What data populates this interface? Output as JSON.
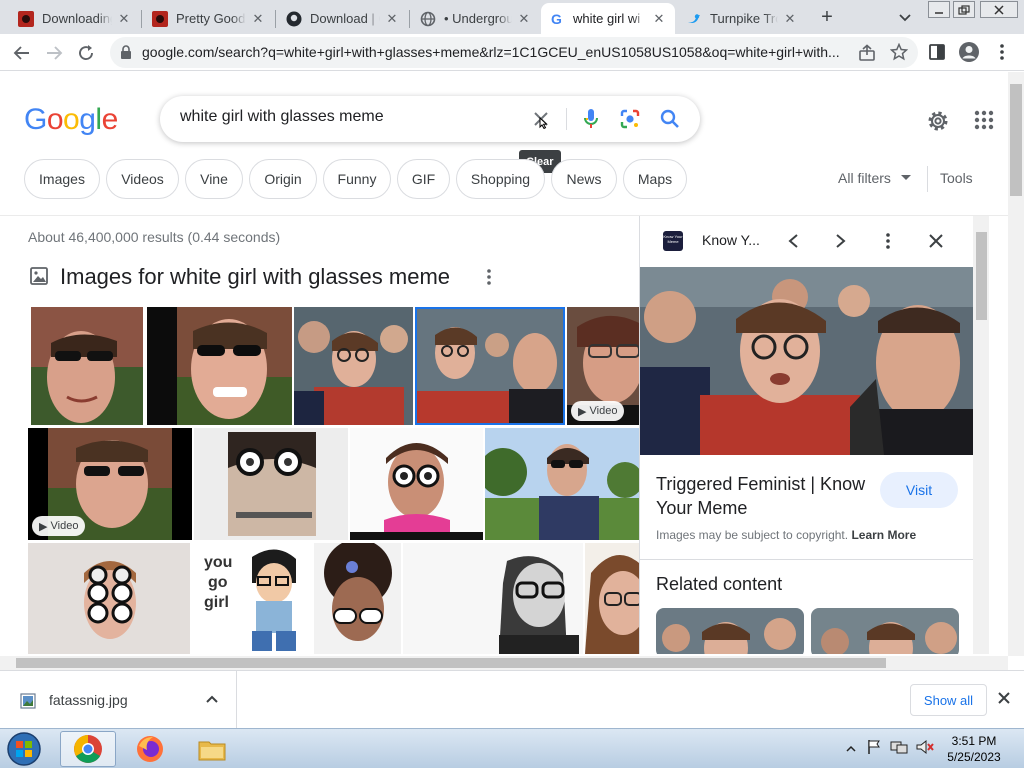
{
  "browser": {
    "tabs": [
      {
        "title": "Downloading",
        "icon": "red-favicon-icon"
      },
      {
        "title": "Pretty Good",
        "icon": "red-favicon-icon"
      },
      {
        "title": "Download | C",
        "icon": "github-icon"
      },
      {
        "title": "• Undergrou",
        "icon": "globe-icon"
      },
      {
        "title": "white girl wi",
        "icon": "google-icon",
        "active": true
      },
      {
        "title": "Turnpike Tro",
        "icon": "twitter-icon"
      }
    ],
    "url": "google.com/search?q=white+girl+with+glasses+meme&rlz=1C1GCEU_enUS1058US1058&oq=white+girl+with..."
  },
  "google": {
    "logo": [
      "G",
      "o",
      "o",
      "g",
      "l",
      "e"
    ],
    "logo_colors": [
      "#4285F4",
      "#EA4335",
      "#FBBC05",
      "#4285F4",
      "#34A853",
      "#EA4335"
    ],
    "query": "white girl with glasses meme",
    "clear_tooltip": "Clear",
    "chips": [
      "Images",
      "Videos",
      "Vine",
      "Origin",
      "Funny",
      "GIF",
      "Shopping",
      "News",
      "Maps"
    ],
    "all_filters": "All filters",
    "tools": "Tools",
    "result_stats": "About 46,400,000 results (0.44 seconds)",
    "images_header": "Images for white girl with glasses meme",
    "video_badge": "Video"
  },
  "panel": {
    "source_name": "Know Y...",
    "source_icon_text": "Know Your Meme",
    "title": "Triggered Feminist | Know Your Meme",
    "visit": "Visit",
    "copyright": "Images may be subject to copyright.",
    "learn_more": "Learn More",
    "related": "Related content"
  },
  "downloads": {
    "file": "fatassnig.jpg",
    "show_all": "Show all"
  },
  "taskbar": {
    "time": "3:51 PM",
    "date": "5/25/2023"
  },
  "colors": {
    "accent": "#1a73e8",
    "tab_strip": "#dee1e6"
  }
}
